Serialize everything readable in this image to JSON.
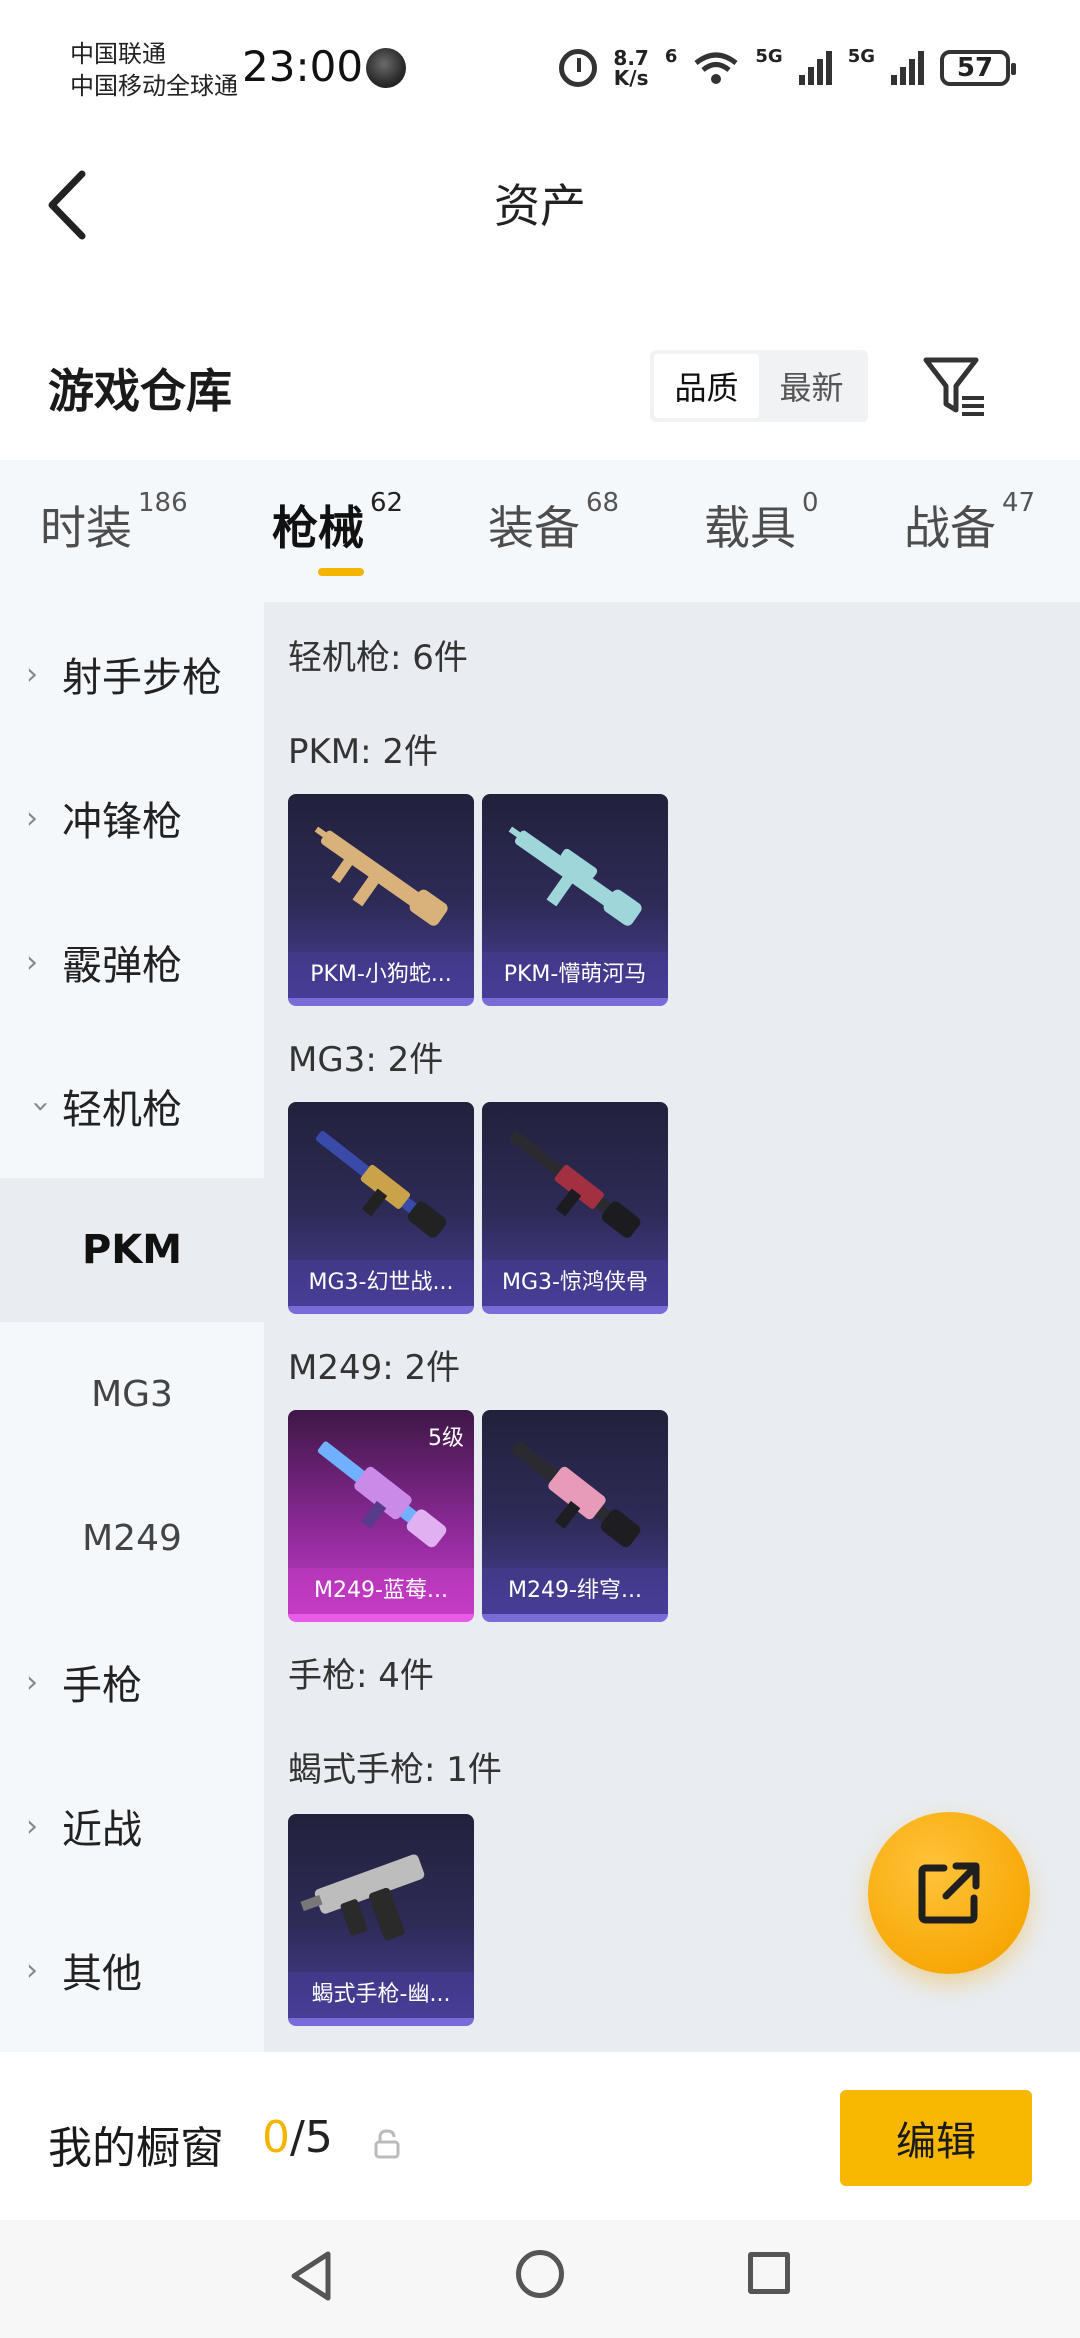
{
  "status_bar": {
    "carrier_1": "中国联通",
    "carrier_2": "中国移动全球通",
    "time": "23:00",
    "net_speed_value": "8.7",
    "net_speed_unit": "K/s",
    "wifi_label": "6",
    "sim1_label": "5G",
    "sim2_label": "5G",
    "battery": "57"
  },
  "header": {
    "title": "资产"
  },
  "warehouse": {
    "title": "游戏仓库",
    "sort_options": [
      "品质",
      "最新"
    ],
    "sort_selected": "品质"
  },
  "tabs": [
    {
      "label": "时装",
      "count": "186"
    },
    {
      "label": "枪械",
      "count": "62",
      "active": true
    },
    {
      "label": "装备",
      "count": "68"
    },
    {
      "label": "载具",
      "count": "0"
    },
    {
      "label": "战备",
      "count": "47"
    }
  ],
  "sidebar": {
    "items": [
      {
        "label": "射手步枪",
        "expanded": false
      },
      {
        "label": "冲锋枪",
        "expanded": false
      },
      {
        "label": "霰弹枪",
        "expanded": false
      },
      {
        "label": "轻机枪",
        "expanded": true
      },
      {
        "label": "PKM",
        "sub": true,
        "selected": true
      },
      {
        "label": "MG3",
        "sub": true
      },
      {
        "label": "M249",
        "sub": true
      },
      {
        "label": "手枪",
        "expanded": false
      },
      {
        "label": "近战",
        "expanded": false
      },
      {
        "label": "其他",
        "expanded": false
      }
    ]
  },
  "content": {
    "category_lmg": "轻机枪: 6件",
    "group_pkm": "PKM: 2件",
    "group_mg3": "MG3: 2件",
    "group_m249": "M249: 2件",
    "category_pistol": "手枪: 4件",
    "group_scorpion": "蝎式手枪: 1件",
    "cards": [
      {
        "name": "PKM-小狗蛇...",
        "gun_color": "#d8b27a"
      },
      {
        "name": "PKM-懵萌河马",
        "gun_color": "#9fd6d9"
      },
      {
        "name": "MG3-幻世战...",
        "gun_color": "#c9a24a"
      },
      {
        "name": "MG3-惊鸿侠骨",
        "gun_color": "#a33040"
      },
      {
        "name": "M249-蓝莓...",
        "gun_color": "#c98ae8",
        "level": "5级",
        "pink": true
      },
      {
        "name": "M249-绯穹...",
        "gun_color": "#e79bb8"
      },
      {
        "name": "蝎式手枪-幽...",
        "gun_color": "#bdbdbd"
      }
    ]
  },
  "showcase": {
    "title": "我的橱窗",
    "used": "0",
    "total": "/5",
    "edit_label": "编辑"
  },
  "colors": {
    "accent": "#f5b400",
    "card_purple": "#4b3f98",
    "card_pink": "#c23cc2"
  }
}
